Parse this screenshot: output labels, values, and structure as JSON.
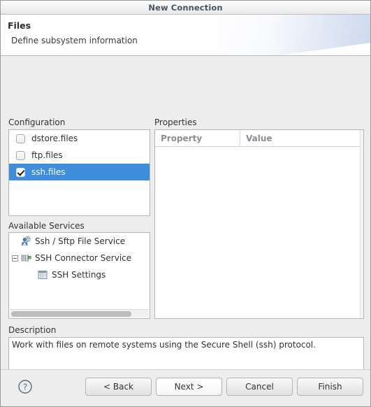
{
  "window": {
    "title": "New Connection"
  },
  "banner": {
    "title": "Files",
    "subtitle": "Define subsystem information"
  },
  "configuration": {
    "label": "Configuration",
    "items": [
      {
        "label": "dstore.files",
        "checked": false,
        "selected": false
      },
      {
        "label": "ftp.files",
        "checked": false,
        "selected": false
      },
      {
        "label": "ssh.files",
        "checked": true,
        "selected": true
      }
    ]
  },
  "services": {
    "label": "Available Services",
    "items": [
      {
        "label": "Ssh / Sftp File Service",
        "icon": "ssh-sftp-file-service-icon",
        "indent": 1,
        "twisty": "none"
      },
      {
        "label": "SSH Connector Service",
        "icon": "ssh-connector-service-icon",
        "indent": 0,
        "twisty": "expanded"
      },
      {
        "label": "SSH Settings",
        "icon": "ssh-settings-icon",
        "indent": 2,
        "twisty": "none"
      }
    ]
  },
  "properties": {
    "label": "Properties",
    "columns": [
      "Property",
      "Value"
    ],
    "rows": []
  },
  "description": {
    "label": "Description",
    "text": "Work with files on remote systems using the Secure Shell (ssh) protocol."
  },
  "footer": {
    "help_label": "?",
    "buttons": [
      {
        "label": "< Back",
        "default": false
      },
      {
        "label": "Next >",
        "default": true
      },
      {
        "label": "Cancel",
        "default": false
      },
      {
        "label": "Finish",
        "default": false
      }
    ]
  },
  "colors": {
    "selection_blue": "#3e8ede",
    "dialog_bg": "#ededed",
    "field_bg": "#ffffff",
    "border": "#b6b6b6",
    "header_text": "#8a8f94"
  }
}
